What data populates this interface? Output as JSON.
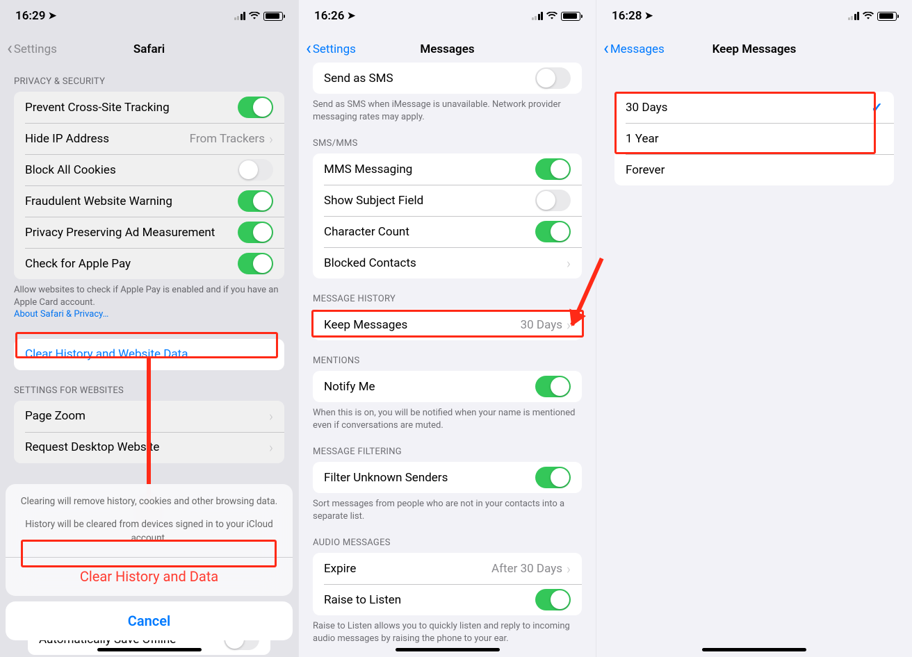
{
  "screen1": {
    "status_time": "16:29",
    "nav_back": "Settings",
    "nav_title": "Safari",
    "section_privacy": "PRIVACY & SECURITY",
    "rows_privacy": {
      "prevent_tracking": "Prevent Cross-Site Tracking",
      "hide_ip": "Hide IP Address",
      "hide_ip_value": "From Trackers",
      "block_cookies": "Block All Cookies",
      "fraud_warning": "Fraudulent Website Warning",
      "privacy_ad": "Privacy Preserving Ad Measurement",
      "apple_pay": "Check for Apple Pay"
    },
    "footer_privacy": "Allow websites to check if Apple Pay is enabled and if you have an Apple Card account.",
    "footer_link": "About Safari & Privacy…",
    "clear_history": "Clear History and Website Data",
    "section_websites": "SETTINGS FOR WEBSITES",
    "rows_websites": {
      "page_zoom": "Page Zoom",
      "request_desktop": "Request Desktop Website"
    },
    "reading_auto": "Automatically Save Offline",
    "sheet_msg1": "Clearing will remove history, cookies and other browsing data.",
    "sheet_msg2": "History will be cleared from devices signed in to your iCloud account.",
    "sheet_destructive": "Clear History and Data",
    "sheet_cancel": "Cancel"
  },
  "screen2": {
    "status_time": "16:26",
    "nav_back": "Settings",
    "nav_title": "Messages",
    "send_sms": "Send as SMS",
    "send_sms_footer": "Send as SMS when iMessage is unavailable. Network provider messaging rates may apply.",
    "section_smsmms": "SMS/MMS",
    "mms": "MMS Messaging",
    "subject": "Show Subject Field",
    "char_count": "Character Count",
    "blocked": "Blocked Contacts",
    "section_history": "MESSAGE HISTORY",
    "keep_messages": "Keep Messages",
    "keep_messages_value": "30 Days",
    "section_mentions": "MENTIONS",
    "notify_me": "Notify Me",
    "notify_footer": "When this is on, you will be notified when your name is mentioned even if conversations are muted.",
    "section_filter": "MESSAGE FILTERING",
    "filter_unknown": "Filter Unknown Senders",
    "filter_footer": "Sort messages from people who are not in your contacts into a separate list.",
    "section_audio": "AUDIO MESSAGES",
    "expire": "Expire",
    "expire_value": "After 30 Days",
    "raise": "Raise to Listen",
    "raise_footer": "Raise to Listen allows you to quickly listen and reply to incoming audio messages by raising the phone to your ear."
  },
  "screen3": {
    "status_time": "16:28",
    "nav_back": "Messages",
    "nav_title": "Keep Messages",
    "opt_30": "30 Days",
    "opt_1y": "1 Year",
    "opt_forever": "Forever"
  }
}
